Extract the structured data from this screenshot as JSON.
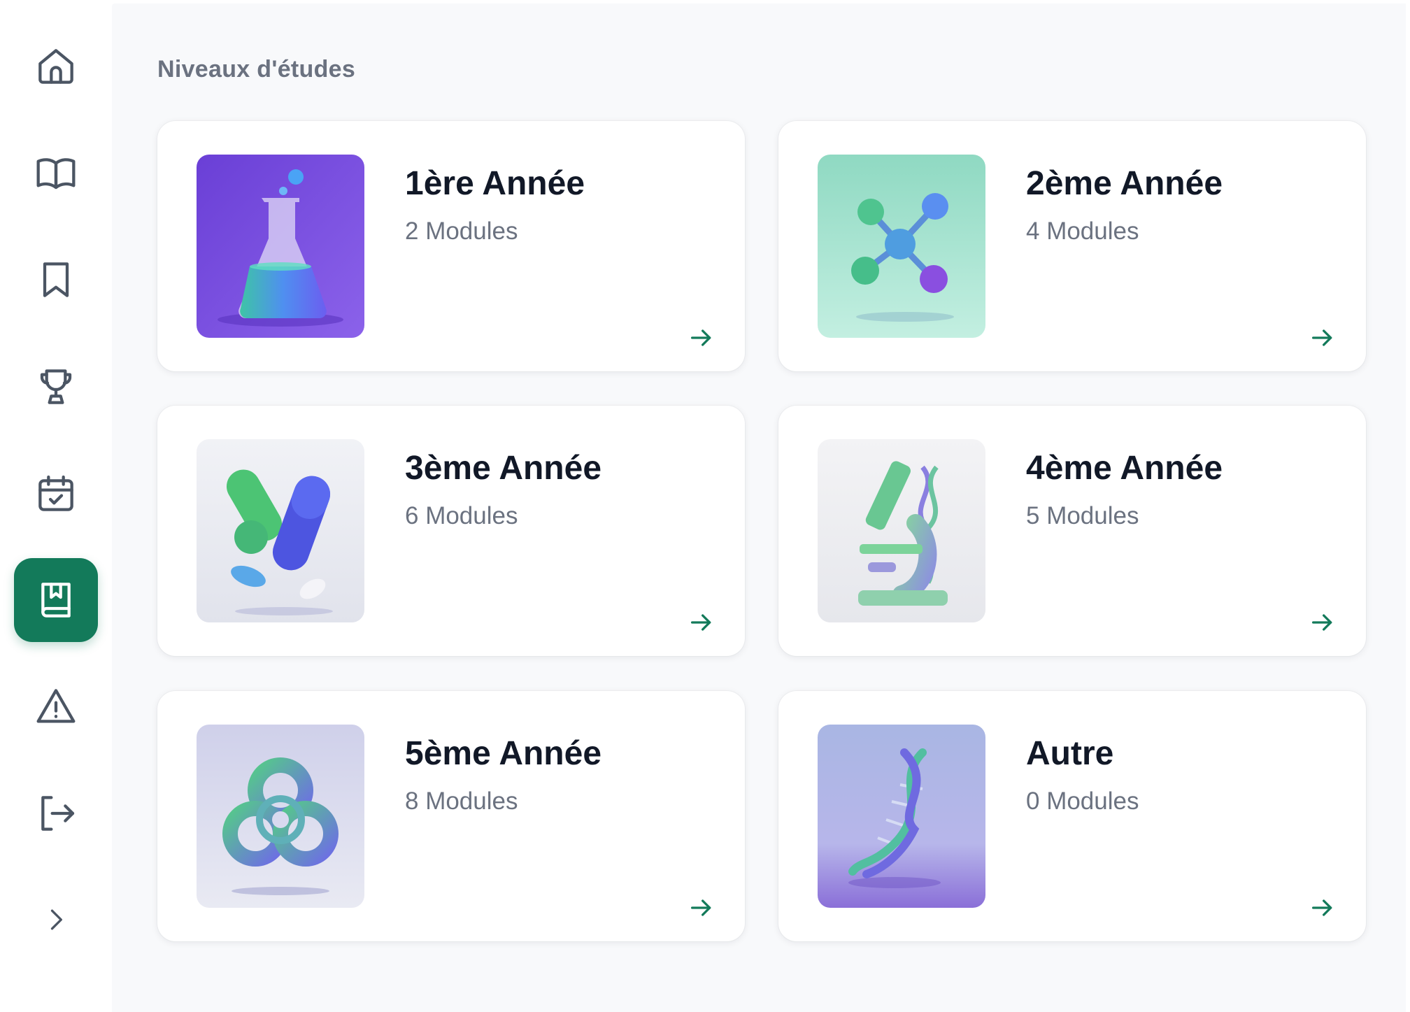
{
  "sidebar": {
    "items": [
      {
        "name": "home",
        "icon": "home-icon"
      },
      {
        "name": "courses",
        "icon": "book-open-icon"
      },
      {
        "name": "bookmarks",
        "icon": "bookmark-icon"
      },
      {
        "name": "leaderboard",
        "icon": "trophy-icon"
      },
      {
        "name": "planning",
        "icon": "calendar-check-icon"
      },
      {
        "name": "study-levels",
        "icon": "book-bookmark-icon",
        "active": true
      },
      {
        "name": "reports",
        "icon": "alert-triangle-icon"
      },
      {
        "name": "logout",
        "icon": "logout-icon"
      }
    ],
    "expand_icon": "chevron-right-icon",
    "active_color": "#137a5a"
  },
  "main": {
    "title": "Niveaux d'études",
    "levels": [
      {
        "title": "1ère Année",
        "subtitle": "2 Modules",
        "image": "flask-illustration"
      },
      {
        "title": "2ème Année",
        "subtitle": "4 Modules",
        "image": "molecule-illustration"
      },
      {
        "title": "3ème Année",
        "subtitle": "6 Modules",
        "image": "pills-illustration"
      },
      {
        "title": "4ème Année",
        "subtitle": "5 Modules",
        "image": "microscope-illustration"
      },
      {
        "title": "5ème Année",
        "subtitle": "8 Modules",
        "image": "biohazard-illustration"
      },
      {
        "title": "Autre",
        "subtitle": "0 Modules",
        "image": "dna-illustration"
      }
    ],
    "arrow_icon": "arrow-right-icon",
    "accent_color": "#137a5a"
  }
}
